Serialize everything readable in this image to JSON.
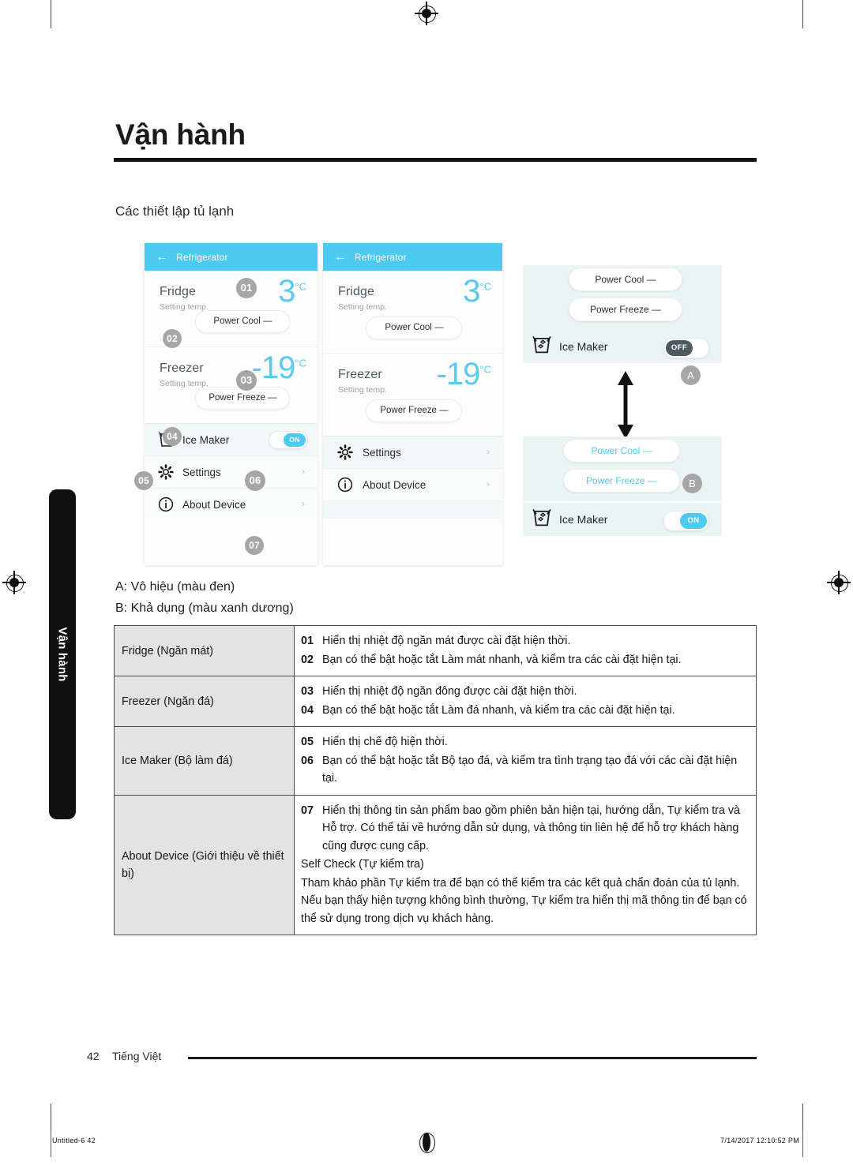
{
  "page": {
    "title": "Vận hành",
    "section_heading": "Các thiết lập tủ lạnh",
    "side_tab_label": "Vận hành"
  },
  "phone_a": {
    "header": {
      "back_icon": "back-arrow-icon",
      "title": "Refrigerator"
    },
    "fridge": {
      "name": "Fridge",
      "sub": "Setting temp.",
      "value": "3",
      "unit": "°C",
      "pill": "Power Cool",
      "pill_dash": "—"
    },
    "freezer": {
      "name": "Freezer",
      "sub": "Setting temp.",
      "value": "-19",
      "unit": "°C",
      "pill": "Power Freeze",
      "pill_dash": "—"
    },
    "ice_maker": {
      "label": "Ice Maker",
      "toggle": "ON"
    },
    "settings": {
      "label": "Settings",
      "chevron": "›"
    },
    "about": {
      "label": "About Device",
      "chevron": "›"
    },
    "bubbles": {
      "b01": "01",
      "b02": "02",
      "b03": "03",
      "b04": "04",
      "b05": "05",
      "b06": "06",
      "b07": "07"
    }
  },
  "phone_b": {
    "header": {
      "back_icon": "back-arrow-icon",
      "title": "Refrigerator"
    },
    "fridge": {
      "name": "Fridge",
      "sub": "Setting temp.",
      "value": "3",
      "unit": "°C",
      "pill": "Power Cool",
      "pill_dash": "—"
    },
    "freezer": {
      "name": "Freezer",
      "sub": "Setting temp.",
      "value": "-19",
      "unit": "°C",
      "pill": "Power Freeze",
      "pill_dash": "—"
    },
    "settings": {
      "label": "Settings",
      "chevron": "›"
    },
    "about": {
      "label": "About Device",
      "chevron": "›"
    }
  },
  "callout": {
    "top": {
      "power_cool": "Power Cool",
      "power_cool_dash": "—",
      "power_freeze": "Power Freeze",
      "power_freeze_dash": "—",
      "ice_maker_label": "Ice Maker",
      "ice_maker_toggle": "OFF",
      "badge": "A"
    },
    "bottom": {
      "power_cool": "Power Cool",
      "power_cool_dash": "—",
      "power_freeze": "Power Freeze",
      "power_freeze_dash": "—",
      "ice_maker_label": "Ice Maker",
      "ice_maker_toggle": "ON",
      "badge": "B"
    }
  },
  "legend": {
    "a": "A: Vô hiệu (màu đen)",
    "b": "B: Khả dụng (màu xanh dương)"
  },
  "table": {
    "rows": [
      {
        "key": "Fridge (Ngăn mát)",
        "items": [
          {
            "num": "01",
            "text": "Hiển thị nhiệt độ ngăn mát được cài đặt hiện thời."
          },
          {
            "num": "02",
            "text": "Bạn có thể bật hoặc tắt Làm mát nhanh, và kiểm tra các cài đặt hiện tại."
          }
        ]
      },
      {
        "key": "Freezer (Ngăn đá)",
        "items": [
          {
            "num": "03",
            "text": "Hiển thị nhiệt độ ngăn đông được cài đặt hiện thời."
          },
          {
            "num": "04",
            "text": "Bạn có thể bật hoặc tắt Làm đá nhanh, và kiểm tra các cài đặt hiện tại."
          }
        ]
      },
      {
        "key": "Ice Maker (Bộ làm đá)",
        "items": [
          {
            "num": "05",
            "text": "Hiển thị chế độ hiện thời."
          },
          {
            "num": "06",
            "text": "Bạn có thể bật hoặc tắt Bộ tạo đá, và kiểm tra tình trạng tạo đá với các cài đặt hiện tại."
          }
        ]
      },
      {
        "key": "About Device (Giới thiệu về thiết bị)",
        "items": [
          {
            "num": "07",
            "text": "Hiển thị thông tin sản phẩm bao gồm phiên bản hiện tại, hướng dẫn, Tự kiểm tra và Hỗ trợ. Có thể tải về hướng dẫn sử dụng, và thông tin liên hệ để hỗ trợ khách hàng cũng được cung cấp."
          }
        ],
        "paragraphs": [
          "Self Check (Tự kiểm tra)",
          "Tham khảo phần Tự kiểm tra để bạn có thể kiểm tra các kết quả chẩn đoán của tủ lạnh. Nếu bạn thấy hiện tượng không bình thường, Tự kiểm tra hiển thị mã thông tin để bạn có thể sử dụng trong dịch vụ khách hàng."
        ]
      }
    ]
  },
  "footer": {
    "page_number": "42",
    "language": "Tiếng Việt"
  },
  "print_slug": {
    "file": "Untitled-6   42",
    "timestamp": "7/14/2017   12:10:52 PM"
  },
  "colors": {
    "accent_cyan": "#4ccaf2",
    "temp_cyan": "#5bc9f2",
    "bubble_grey": "#a6a6a6",
    "toggle_off": "#4e5b5e",
    "row_bg": "#f2f7f8",
    "callout_bg": "#eaf4f4"
  }
}
